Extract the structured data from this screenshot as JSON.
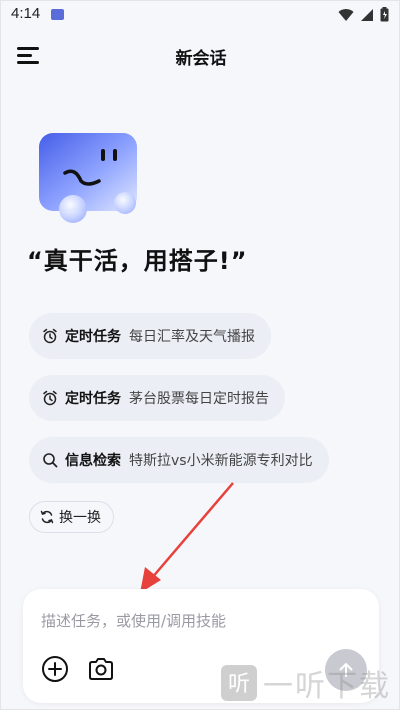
{
  "status_bar": {
    "time": "4:14"
  },
  "header": {
    "title": "新会话"
  },
  "slogan": "“真干活，用搭子!”",
  "suggestions": [
    {
      "category": "定时任务",
      "text": "每日汇率及天气播报",
      "icon": "alarm-clock-icon"
    },
    {
      "category": "定时任务",
      "text": "茅台股票每日定时报告",
      "icon": "alarm-clock-icon"
    },
    {
      "category": "信息检索",
      "text": "特斯拉vs小米新能源专利对比",
      "icon": "search-icon"
    }
  ],
  "refresh_label": "换一换",
  "input": {
    "placeholder": "描述任务，或使用/调用技能",
    "value": ""
  },
  "watermark": {
    "text": "一听下载"
  },
  "colors": {
    "background": "#f6f7fb",
    "chip": "#eceef6",
    "send_button": "#c9cad1",
    "annotation_arrow": "#e8403a",
    "mascot": "#5a73f0"
  }
}
